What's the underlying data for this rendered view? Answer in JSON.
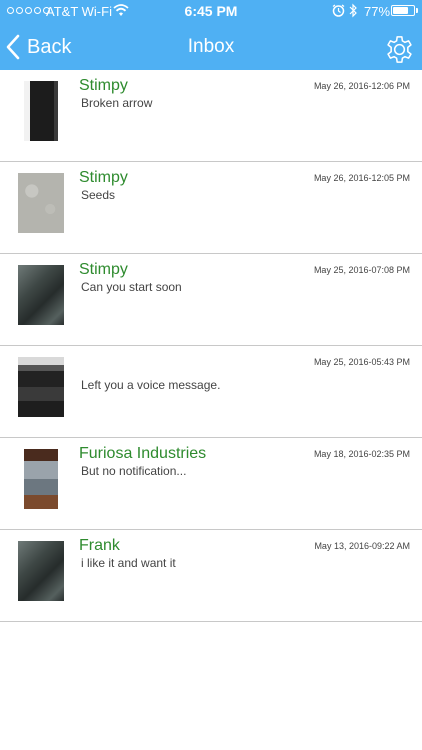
{
  "status_bar": {
    "carrier": "AT&T Wi-Fi",
    "time": "6:45 PM",
    "battery_percent": "77%",
    "battery_level": 0.77,
    "signal_strength": 0
  },
  "nav": {
    "back_label": "Back",
    "title": "Inbox",
    "settings_icon": "gear-icon"
  },
  "colors": {
    "header": "#4fb0f3",
    "sender": "#2e8b2e"
  },
  "messages": [
    {
      "sender": "Stimpy",
      "preview": "Broken arrow",
      "timestamp": "May 26, 2016-12:06 PM",
      "thumbnail": "dark-object-photo"
    },
    {
      "sender": "Stimpy",
      "preview": "Seeds",
      "timestamp": "May 26, 2016-12:05 PM",
      "thumbnail": "carpet-photo"
    },
    {
      "sender": "Stimpy",
      "preview": "Can you start soon",
      "timestamp": "May 25, 2016-07:08 PM",
      "thumbnail": "car-seat-photo"
    },
    {
      "sender": "",
      "preview": "Left you a voice message.",
      "timestamp": "May 25, 2016-05:43 PM",
      "thumbnail": "car-radio-photo"
    },
    {
      "sender": "Furiosa Industries",
      "preview": "But no notification...",
      "timestamp": "May 18, 2016-02:35 PM",
      "thumbnail": "couch-photo"
    },
    {
      "sender": "Frank",
      "preview": "i like it and want it",
      "timestamp": "May 13, 2016-09:22 AM",
      "thumbnail": "car-seat-photo"
    }
  ]
}
